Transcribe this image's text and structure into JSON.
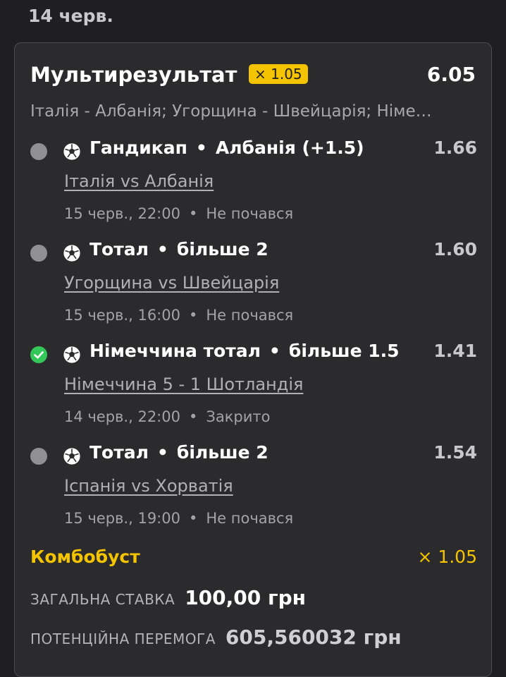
{
  "date_header": "14 черв.",
  "bet": {
    "title": "Мультирезультат",
    "multiplier_badge": "× 1.05",
    "total_odds": "6.05",
    "events_summary": "Італія - Албанія; Угорщина - Швейцарія; Німе…"
  },
  "legs": [
    {
      "status": "pending",
      "icon": "soccer-ball-icon",
      "market": "Гандикап",
      "selection": "Албанія (+1.5)",
      "odds": "1.66",
      "match": "Італія vs Албанія",
      "datetime": "15 черв., 22:00",
      "state": "Не почався"
    },
    {
      "status": "pending",
      "icon": "soccer-ball-icon",
      "market": "Тотал",
      "selection": "більше 2",
      "odds": "1.60",
      "match": "Угорщина vs Швейцарія",
      "datetime": "15 черв., 16:00",
      "state": "Не почався"
    },
    {
      "status": "won",
      "icon": "soccer-ball-icon",
      "market": "Німеччина тотал",
      "selection": "більше 1.5",
      "odds": "1.41",
      "match": "Німеччина 5 - 1 Шотландія",
      "datetime": "14 черв., 22:00",
      "state": "Закрито"
    },
    {
      "status": "pending",
      "icon": "soccer-ball-icon",
      "market": "Тотал",
      "selection": "більше 2",
      "odds": "1.54",
      "match": "Іспанія vs Хорватія",
      "datetime": "15 черв., 19:00",
      "state": "Не почався"
    }
  ],
  "separator": "•",
  "combo_boost": {
    "label": "Комбобуст",
    "value": "× 1.05"
  },
  "stake": {
    "label": "ЗАГАЛЬНА СТАВКА",
    "value": "100,00 грн"
  },
  "potential_win": {
    "label": "ПОТЕНЦІЙНА ПЕРЕМОГА",
    "value": "605,560032 грн"
  },
  "colors": {
    "background": "#1f1f21",
    "card": "#2b2b2e",
    "accent": "#f5c400",
    "win": "#34c759",
    "pending": "#8f8f94"
  }
}
